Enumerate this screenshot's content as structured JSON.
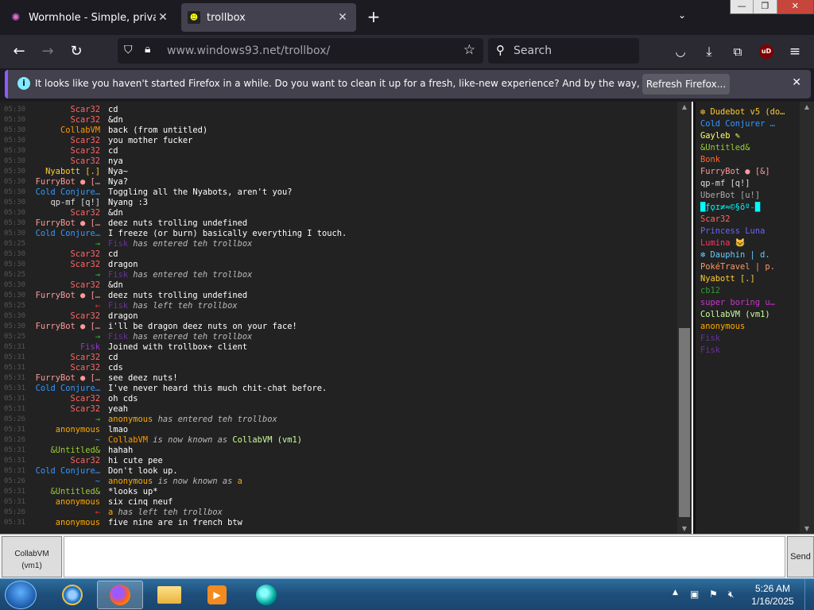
{
  "browser": {
    "tabs": [
      {
        "title": "Wormhole - Simple, private file",
        "favicon": "wormhole-icon"
      },
      {
        "title": "trollbox",
        "favicon": "trollbox-icon",
        "active": true
      }
    ],
    "url_host": "www.windows93.net",
    "url_path": "/trollbox/",
    "search_placeholder": "Search",
    "ublock_label": "uD"
  },
  "notification": {
    "message": "It looks like you haven't started Firefox in a while. Do you want to clean it up for a fresh, like-new experience? And by the way, welcome back!",
    "button": "Refresh Firefox..."
  },
  "chat": {
    "messages": [
      {
        "time": "05:30",
        "nick": "Scar32",
        "color": "#f66",
        "text": "cd"
      },
      {
        "time": "05:30",
        "nick": "Scar32",
        "color": "#f66",
        "text": "&dn"
      },
      {
        "time": "05:30",
        "nick": "CollabVM",
        "color": "#f90",
        "text": "back (from untitled)"
      },
      {
        "time": "05:30",
        "nick": "Scar32",
        "color": "#f66",
        "text": "you mother fucker"
      },
      {
        "time": "05:30",
        "nick": "Scar32",
        "color": "#f66",
        "text": "cd"
      },
      {
        "time": "05:30",
        "nick": "Scar32",
        "color": "#f66",
        "text": "nya"
      },
      {
        "time": "05:30",
        "nick": "Nyabott [.]",
        "color": "#fc3",
        "text": "Nya~"
      },
      {
        "time": "05:30",
        "nick": "FurryBot ● […",
        "color": "#f99",
        "text": "Nya?"
      },
      {
        "time": "05:30",
        "nick": "Cold Conjure…",
        "color": "#39f",
        "text": "Toggling all the Nyabots, aren't you?"
      },
      {
        "time": "05:30",
        "nick": "qp-mf [q!]",
        "color": "#ddd",
        "text": "Nyang :3"
      },
      {
        "time": "05:30",
        "nick": "Scar32",
        "color": "#f66",
        "text": "&dn"
      },
      {
        "time": "05:30",
        "nick": "FurryBot ● […",
        "color": "#f99",
        "text": "deez nuts trolling undefined"
      },
      {
        "time": "05:30",
        "nick": "Cold Conjure…",
        "color": "#39f",
        "text": "I freeze (or burn) basically everything I touch."
      },
      {
        "time": "05:25",
        "nick": "→",
        "color": "#3c3",
        "text": "Fisk has entered teh trollbox",
        "sys": true,
        "who": "Fisk",
        "whocolor": "#639"
      },
      {
        "time": "05:30",
        "nick": "Scar32",
        "color": "#f66",
        "text": "cd"
      },
      {
        "time": "05:30",
        "nick": "Scar32",
        "color": "#f66",
        "text": "dragon"
      },
      {
        "time": "05:25",
        "nick": "→",
        "color": "#3c3",
        "text": "Fisk has entered teh trollbox",
        "sys": true,
        "who": "Fisk",
        "whocolor": "#639"
      },
      {
        "time": "05:30",
        "nick": "Scar32",
        "color": "#f66",
        "text": "&dn"
      },
      {
        "time": "05:30",
        "nick": "FurryBot ● […",
        "color": "#f99",
        "text": "deez nuts trolling undefined"
      },
      {
        "time": "05:25",
        "nick": "←",
        "color": "#f33",
        "text": "Fisk has left teh trollbox",
        "sys": true,
        "who": "Fisk",
        "whocolor": "#639"
      },
      {
        "time": "05:30",
        "nick": "Scar32",
        "color": "#f66",
        "text": "dragon"
      },
      {
        "time": "05:30",
        "nick": "FurryBot ● […",
        "color": "#f99",
        "text": "i'll be dragon deez nuts on your face!"
      },
      {
        "time": "05:25",
        "nick": "→",
        "color": "#3c3",
        "text": "Fisk has entered teh trollbox",
        "sys": true,
        "who": "Fisk",
        "whocolor": "#639"
      },
      {
        "time": "05:31",
        "nick": "Fisk",
        "color": "#93c",
        "text": "Joined with trollbox+ client"
      },
      {
        "time": "05:31",
        "nick": "Scar32",
        "color": "#f66",
        "text": "cd"
      },
      {
        "time": "05:31",
        "nick": "Scar32",
        "color": "#f66",
        "text": "cds"
      },
      {
        "time": "05:31",
        "nick": "FurryBot ● […",
        "color": "#f99",
        "text": "see deez nuts!"
      },
      {
        "time": "05:31",
        "nick": "Cold Conjure…",
        "color": "#39f",
        "text": "I've never heard this much chit-chat before."
      },
      {
        "time": "05:31",
        "nick": "Scar32",
        "color": "#f66",
        "text": "oh cds"
      },
      {
        "time": "05:31",
        "nick": "Scar32",
        "color": "#f66",
        "text": "yeah"
      },
      {
        "time": "05:26",
        "nick": "→",
        "color": "#3c3",
        "text": "anonymous has entered teh trollbox",
        "sys": true,
        "who": "anonymous",
        "whocolor": "#fa0"
      },
      {
        "time": "05:31",
        "nick": "anonymous",
        "color": "#fa0",
        "text": "lmao"
      },
      {
        "time": "05:26",
        "nick": "~",
        "color": "#39f",
        "text": "CollabVM is now known as CollabVM (vm1)",
        "sys": true,
        "who": "CollabVM",
        "whocolor": "#f90",
        "tail": "CollabVM (vm1)",
        "tailcolor": "#cf9"
      },
      {
        "time": "05:31",
        "nick": "&Untitled&",
        "color": "#9c3",
        "text": "hahah"
      },
      {
        "time": "05:31",
        "nick": "Scar32",
        "color": "#f66",
        "text": "hi cute pee"
      },
      {
        "time": "05:31",
        "nick": "Cold Conjure…",
        "color": "#39f",
        "text": "Don't look up."
      },
      {
        "time": "05:26",
        "nick": "~",
        "color": "#39f",
        "text": "anonymous is now known as a",
        "sys": true,
        "who": "anonymous",
        "whocolor": "#fa0",
        "tail": "a",
        "tailcolor": "#fa0"
      },
      {
        "time": "05:31",
        "nick": "&Untitled&",
        "color": "#9c3",
        "text": "*looks up*"
      },
      {
        "time": "05:31",
        "nick": "anonymous",
        "color": "#fa0",
        "text": "six cinq neuf"
      },
      {
        "time": "05:26",
        "nick": "←",
        "color": "#f33",
        "text": "a has left teh trollbox",
        "sys": true,
        "who": "a",
        "whocolor": "#fa0"
      },
      {
        "time": "05:31",
        "nick": "anonymous",
        "color": "#fa0",
        "text": "five nine are in french btw"
      }
    ]
  },
  "userlist": [
    {
      "name": "❇ Dudebot v5 (do…",
      "color": "#fc3"
    },
    {
      "name": "Cold Conjurer …",
      "color": "#39f"
    },
    {
      "name": "Gayleb ✎",
      "color": "#ff6"
    },
    {
      "name": "&Untitled&",
      "color": "#9c3"
    },
    {
      "name": "Bonk",
      "color": "#f63"
    },
    {
      "name": "FurryBot ● [&]",
      "color": "#f99"
    },
    {
      "name": "qp-mf [q!]",
      "color": "#ddd"
    },
    {
      "name": "UberBot [u!]",
      "color": "#aaa"
    },
    {
      "name": "█ƒǫɪ≠≈©§õº₋█",
      "color": "#0ff"
    },
    {
      "name": "Scar32",
      "color": "#f66"
    },
    {
      "name": "Princess Luna",
      "color": "#66f"
    },
    {
      "name": "Lumina 🐱",
      "color": "#f36"
    },
    {
      "name": "❄ Dauphin | d.",
      "color": "#6cf"
    },
    {
      "name": "PokéTravel | p.",
      "color": "#f96"
    },
    {
      "name": "Nyabott [.]",
      "color": "#fc3"
    },
    {
      "name": "cb12",
      "color": "#393"
    },
    {
      "name": "super boring u…",
      "color": "#c3c"
    },
    {
      "name": "CollabVM (vm1)",
      "color": "#cf9"
    },
    {
      "name": "anonymous",
      "color": "#fa0"
    },
    {
      "name": "Fisk",
      "color": "#639"
    },
    {
      "name": "Fisk",
      "color": "#639"
    }
  ],
  "input": {
    "nick_line1": "CollabVM",
    "nick_line2": "(vm1)",
    "send": "Send"
  },
  "taskbar": {
    "time": "5:26 AM",
    "date": "1/16/2025"
  }
}
